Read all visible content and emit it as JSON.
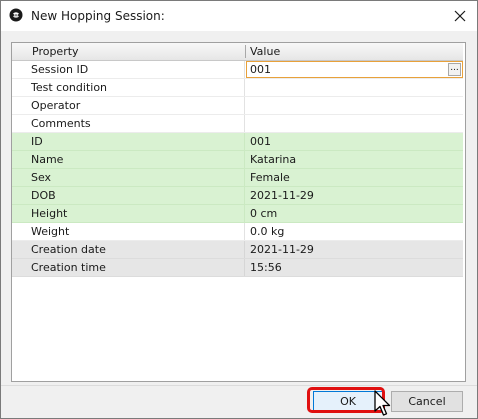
{
  "window": {
    "title": "New Hopping Session:"
  },
  "grid": {
    "header": {
      "property_label": "Property",
      "value_label": "Value"
    },
    "rows": [
      {
        "name": "Session ID",
        "value": "001",
        "style": "edit"
      },
      {
        "name": "Test condition",
        "value": "",
        "style": "white"
      },
      {
        "name": "Operator",
        "value": "",
        "style": "white"
      },
      {
        "name": "Comments",
        "value": "",
        "style": "white"
      },
      {
        "name": "ID",
        "value": "001",
        "style": "green"
      },
      {
        "name": "Name",
        "value": "Katarina",
        "style": "green"
      },
      {
        "name": "Sex",
        "value": "Female",
        "style": "green"
      },
      {
        "name": "DOB",
        "value": "2021-11-29",
        "style": "green"
      },
      {
        "name": "Height",
        "value": "0 cm",
        "style": "green"
      },
      {
        "name": "Weight",
        "value": "0.0 kg",
        "style": "white"
      },
      {
        "name": "Creation date",
        "value": "2021-11-29",
        "style": "gray"
      },
      {
        "name": "Creation time",
        "value": "15:56",
        "style": "gray"
      }
    ],
    "ellipsis_label": "..."
  },
  "buttons": {
    "ok_label": "OK",
    "cancel_label": "Cancel"
  },
  "icons": {
    "app": "app-logo-icon",
    "close": "close-icon",
    "cursor": "mouse-pointer-icon"
  },
  "colors": {
    "green_row": "#d9f2d2",
    "gray_row": "#e6e6e6",
    "edit_border": "#e8a13a",
    "highlight": "#e01010",
    "ok_border": "#0078d7"
  }
}
